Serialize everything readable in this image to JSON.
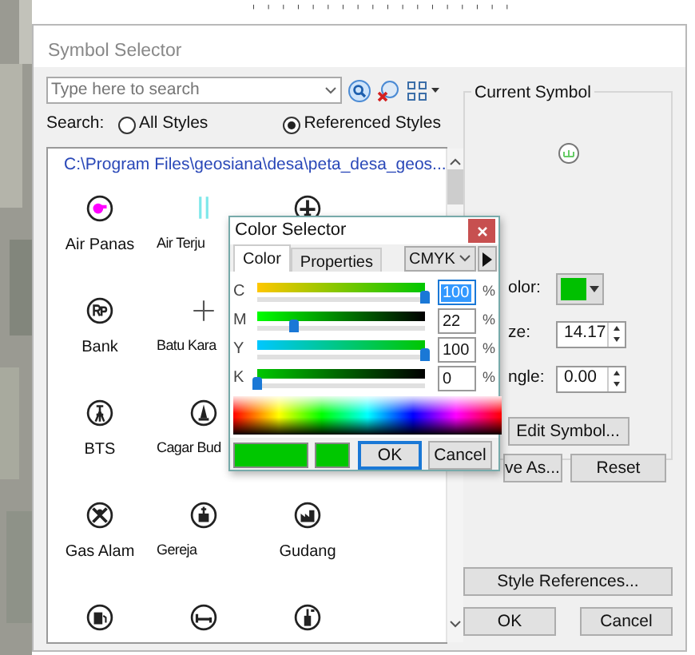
{
  "dialog": {
    "title": "Symbol Selector"
  },
  "search": {
    "placeholder": "Type here to search",
    "label": "Search:",
    "scopes": [
      {
        "label": "All Styles",
        "selected": false
      },
      {
        "label": "Referenced Styles",
        "selected": true
      }
    ]
  },
  "symbol_list": {
    "path": "C:\\Program Files\\geosiana\\desa\\peta_desa_geos...",
    "rows": [
      [
        {
          "label": "Air Panas"
        },
        {
          "label": "Air Terju"
        },
        {}
      ],
      [
        {
          "label": "Bank"
        },
        {
          "label": "Batu Kara"
        }
      ],
      [
        {
          "label": "BTS"
        },
        {
          "label": "Cagar Bud"
        }
      ],
      [
        {
          "label": "Gas Alam"
        },
        {
          "label": "Gereja"
        },
        {
          "label": "Gudang"
        }
      ],
      [
        {},
        {},
        {}
      ]
    ]
  },
  "current_symbol": {
    "title": "Current Symbol",
    "color_label": "olor:",
    "color": "#00c000",
    "size_label": "ze:",
    "size": "14.17",
    "angle_label": "ngle:",
    "angle": "0.00",
    "edit_button": "Edit Symbol...",
    "save_button": "ve As...",
    "reset_button": "Reset"
  },
  "footer": {
    "style_references": "Style References...",
    "ok": "OK",
    "cancel": "Cancel"
  },
  "color_selector": {
    "title": "Color Selector",
    "tabs": [
      {
        "label": "Color",
        "selected": true
      },
      {
        "label": "Properties",
        "selected": false
      }
    ],
    "model": "CMYK",
    "channels": [
      {
        "name": "C",
        "level": 1.0,
        "value": "100",
        "selected": true
      },
      {
        "name": "M",
        "level": 0.22,
        "value": "22",
        "selected": false
      },
      {
        "name": "Y",
        "level": 1.0,
        "value": "100",
        "selected": false
      },
      {
        "name": "K",
        "level": 0,
        "value": "0",
        "selected": false
      }
    ],
    "unit": "%",
    "ok": "OK",
    "cancel": "Cancel"
  }
}
